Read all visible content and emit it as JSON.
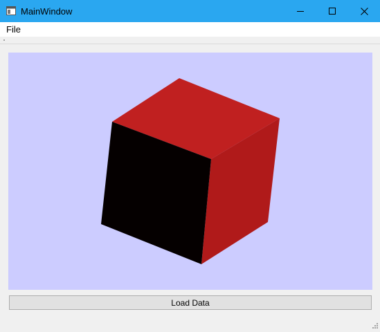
{
  "window": {
    "title": "MainWindow",
    "icons": {
      "app": "app-window-icon",
      "minimize": "minimize-icon",
      "maximize": "maximize-icon",
      "close": "close-icon"
    },
    "colors": {
      "titlebar": "#2aa7f0",
      "viewport_background": "#ccccff",
      "cube_top": "#c02020",
      "cube_right": "#b01a1a",
      "cube_front": "#050000"
    }
  },
  "menu": {
    "items": [
      {
        "label": "File"
      }
    ]
  },
  "viewport": {
    "object": "cube"
  },
  "actions": {
    "load_label": "Load Data"
  }
}
